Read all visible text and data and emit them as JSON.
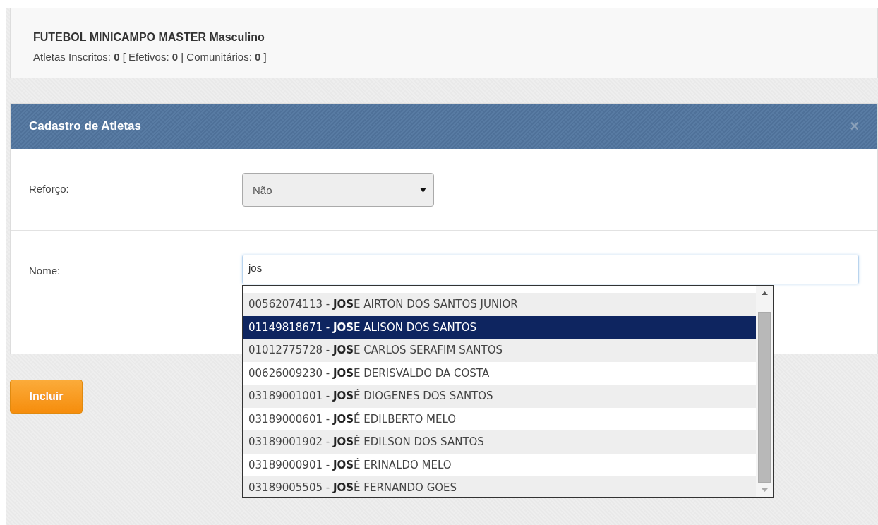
{
  "event_card": {
    "title": "FUTEBOL MINICAMPO MASTER Masculino",
    "summary": "Atletas Inscritos: **0** [ Efetivos: **0** | Comunitários: **0**  ]"
  },
  "modal": {
    "title": "Cadastro de Atletas",
    "close": "×",
    "fields": [
      {
        "kind": "select",
        "label": "Reforço:",
        "value": "Não"
      },
      {
        "kind": "text",
        "label": "Nome:",
        "value": "jos"
      }
    ]
  },
  "autocomplete": [
    {
      "text": "00562074113 - **JOS**E AIRTON DOS SANTOS JUNIOR",
      "selected": false
    },
    {
      "text": "01149818671 - **JOS**E ALISON DOS SANTOS",
      "selected": true
    },
    {
      "text": "01012775728 - **JOS**E CARLOS SERAFIM SANTOS",
      "selected": false
    },
    {
      "text": "00626009230 - **JOS**E DERISVALDO DA COSTA",
      "selected": false
    },
    {
      "text": "03189001001 - **JOS**É DIOGENES DOS SANTOS",
      "selected": false
    },
    {
      "text": "03189000601 - **JOS**É EDILBERTO MELO",
      "selected": false
    },
    {
      "text": "03189001902 - **JOS**É EDILSON DOS SANTOS",
      "selected": false
    },
    {
      "text": "03189000901 - **JOS**É ERINALDO MELO",
      "selected": false
    },
    {
      "text": "03189005505 - **JOS**É FERNANDO GOES",
      "selected": false
    }
  ],
  "submit_button": "Incluir"
}
